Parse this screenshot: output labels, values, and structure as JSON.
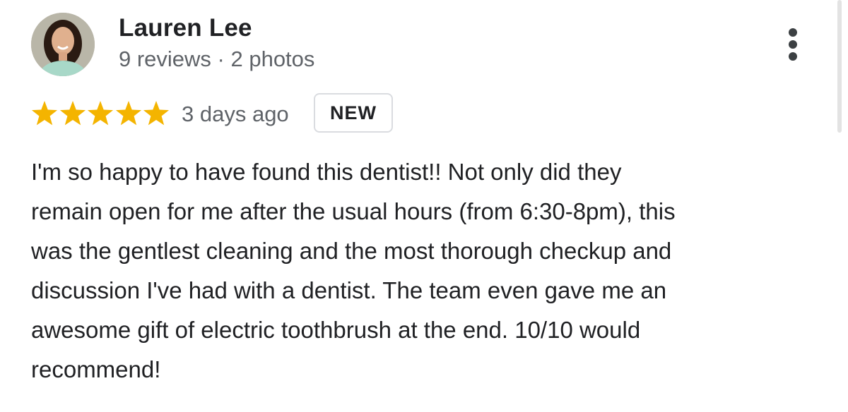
{
  "reviewer": {
    "name": "Lauren Lee",
    "meta": "9 reviews · 2 photos",
    "avatar_icon": "person-avatar"
  },
  "menu": {
    "icon": "more-vert-icon"
  },
  "rating": {
    "stars": 5,
    "max_stars": 5,
    "star_color": "#f4b400",
    "date": "3 days ago",
    "badge": "NEW"
  },
  "review": {
    "lines": [
      "I'm so happy to have found this dentist!! Not only did they",
      "remain open for me after the usual hours (from 6:30-8pm), this",
      "was the gentlest cleaning and the most thorough checkup and",
      "discussion I've had with a dentist. The team even gave me an",
      "awesome gift of electric toothbrush at the end. 10/10 would",
      "recommend!"
    ]
  }
}
